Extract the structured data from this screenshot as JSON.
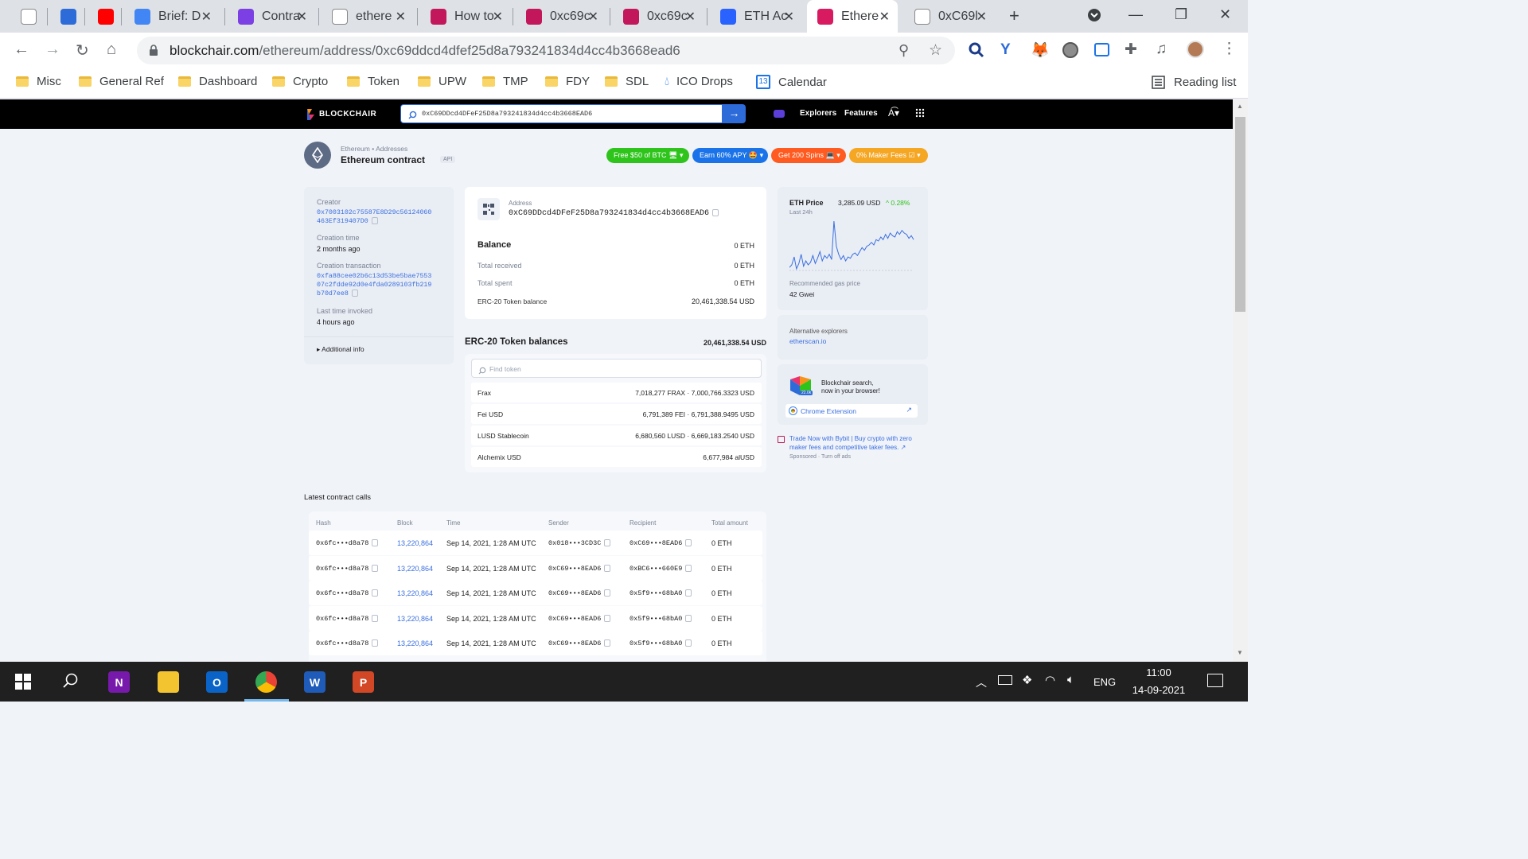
{
  "browser": {
    "tabs": [
      {
        "title": "",
        "icon": "github-icon",
        "color": "#ffffff",
        "fg": "#000000"
      },
      {
        "title": "",
        "icon": "tab-y-icon",
        "color": "#2d6bd9",
        "fg": "#ffffff"
      },
      {
        "title": "",
        "icon": "youtube-icon",
        "color": "#ff0000",
        "fg": "#ffffff"
      },
      {
        "title": "Brief: D",
        "icon": "google-docs-icon",
        "color": "#4285f4",
        "fg": "#ffffff"
      },
      {
        "title": "Contra",
        "icon": "contra-icon",
        "color": "#7b3fe4",
        "fg": "#ffffff"
      },
      {
        "title": "ethere",
        "icon": "google-icon",
        "color": "#ffffff",
        "fg": "#4285f4"
      },
      {
        "title": "How to",
        "icon": "shield-icon",
        "color": "#c2185b",
        "fg": "#ffffff"
      },
      {
        "title": "0xc69c",
        "icon": "shield-icon",
        "color": "#c2185b",
        "fg": "#ffffff"
      },
      {
        "title": "0xc69c",
        "icon": "shield-icon",
        "color": "#c2185b",
        "fg": "#ffffff"
      },
      {
        "title": "ETH Ac",
        "icon": "blue-dots-icon",
        "color": "#2962ff",
        "fg": "#ffffff"
      },
      {
        "title": "Ethere",
        "icon": "blockchair-cube-icon",
        "color": "#d81b60",
        "fg": "#ffffff"
      },
      {
        "title": "0xC69l",
        "icon": "ethereum-icon",
        "color": "#ffffff",
        "fg": "#000000"
      }
    ],
    "url_host": "blockchair.com",
    "url_path": "/ethereum/address/0xc69ddcd4dfef25d8a793241834d4cc4b3668ead6",
    "bookmarks": [
      "Misc",
      "General Ref",
      "Dashboard",
      "Crypto",
      "Token",
      "UPW",
      "TMP",
      "FDY",
      "SDL",
      "ICO Drops",
      "Calendar"
    ],
    "calendar_day": "13",
    "reading_list": "Reading list"
  },
  "site": {
    "logo": "BLOCKCHAIR",
    "search_value": "0xC69DDcd4DFeF25D8a793241834d4cc4b3668EAD6",
    "nav_explorers": "Explorers",
    "nav_features": "Features",
    "breadcrumb_1": "Ethereum",
    "breadcrumb_sep": "•",
    "breadcrumb_2": "Addresses",
    "page_title": "Ethereum contract",
    "api_badge": "API",
    "promos": [
      {
        "label": "Free $50 of BTC 🖥 ▾",
        "color": "#2ec41b"
      },
      {
        "label": "Earn 60% APY 🤩 ▾",
        "color": "#1a73e8"
      },
      {
        "label": "Get 200 Spins 💻 ▾",
        "color": "#ff5a1f"
      },
      {
        "label": "0% Maker Fees ☑ ▾",
        "color": "#f5a623"
      }
    ],
    "info": {
      "creator_label": "Creator",
      "creator_l1": "0x7003102c75587E8D29c56124060",
      "creator_l2": "463Ef319407D0",
      "creation_time_label": "Creation time",
      "creation_time": "2 months ago",
      "creation_tx_label": "Creation transaction",
      "creation_tx_l1": "0xfa88cee02b6c13d53be5bae7553",
      "creation_tx_l2": "07c2fdde92d0e4fda0289103fb219",
      "creation_tx_l3": "b70d7ee8",
      "last_invoked_label": "Last time invoked",
      "last_invoked": "4 hours ago",
      "additional_info": "▸ Additional info"
    },
    "address": {
      "label": "Address",
      "value": "0xC69DDcd4DFeF25D8a793241834d4cc4b3668EAD6",
      "balance_label": "Balance",
      "balance": "0 ETH",
      "received_label": "Total received",
      "received": "0 ETH",
      "spent_label": "Total spent",
      "spent": "0 ETH",
      "erc20_label": "ERC-20 Token balance",
      "erc20": "20,461,338.54 USD"
    },
    "tokens": {
      "title": "ERC-20 Token balances",
      "total": "20,461,338.54 USD",
      "find_placeholder": "Find token",
      "rows": [
        {
          "name": "Frax",
          "value": "7,018,277 FRAX · 7,000,766.3323 USD"
        },
        {
          "name": "Fei USD",
          "value": "6,791,389 FEI · 6,791,388.9495 USD"
        },
        {
          "name": "LUSD Stablecoin",
          "value": "6,680,560 LUSD · 6,669,183.2540 USD"
        },
        {
          "name": "Alchemix USD",
          "value": "6,677,984 alUSD"
        }
      ]
    },
    "eth_price": {
      "label": "ETH Price",
      "price": "3,285.09 USD",
      "change": "^ 0.28%",
      "period": "Last 24h",
      "gas_label": "Recommended gas price",
      "gas": "42 Gwei",
      "series": [
        40,
        44,
        56,
        38,
        46,
        60,
        42,
        50,
        44,
        48,
        58,
        46,
        54,
        64,
        50,
        58,
        54,
        60,
        52,
        110,
        72,
        60,
        52,
        58,
        50,
        56,
        54,
        60,
        62,
        58,
        64,
        70,
        66,
        72,
        74,
        78,
        74,
        82,
        80,
        86,
        82,
        90,
        84,
        92,
        88,
        86,
        94,
        90,
        96,
        92,
        90,
        84,
        88,
        82
      ]
    },
    "alt_explorers": {
      "label": "Alternative explorers",
      "link": "etherscan.io"
    },
    "extension": {
      "line1": "Blockchair search,",
      "line2": "now in your browser!",
      "button": "Chrome Extension",
      "badge": "22.0k"
    },
    "ad": {
      "line1": "Trade Now with Bybit | Buy crypto with zero",
      "line2": "maker fees and competitive taker fees. ↗",
      "sponsored": "Sponsored",
      "sep": "·",
      "turn_off": "Turn off ads"
    },
    "calls": {
      "title": "Latest contract calls",
      "headers": [
        "Hash",
        "Block",
        "Time",
        "Sender",
        "Recipient",
        "Total amount"
      ],
      "rows": [
        {
          "hash": "0x6fc•••d8a78",
          "block": "13,220,864",
          "time": "Sep 14, 2021, 1:28 AM UTC",
          "sender": "0x018•••3CD3C",
          "recipient": "0xC69•••8EAD6",
          "amount": "0 ETH"
        },
        {
          "hash": "0x6fc•••d8a78",
          "block": "13,220,864",
          "time": "Sep 14, 2021, 1:28 AM UTC",
          "sender": "0xC69•••8EAD6",
          "recipient": "0xBC6•••660E9",
          "amount": "0 ETH"
        },
        {
          "hash": "0x6fc•••d8a78",
          "block": "13,220,864",
          "time": "Sep 14, 2021, 1:28 AM UTC",
          "sender": "0xC69•••8EAD6",
          "recipient": "0x5f9•••68bA0",
          "amount": "0 ETH"
        },
        {
          "hash": "0x6fc•••d8a78",
          "block": "13,220,864",
          "time": "Sep 14, 2021, 1:28 AM UTC",
          "sender": "0xC69•••8EAD6",
          "recipient": "0x5f9•••68bA0",
          "amount": "0 ETH"
        },
        {
          "hash": "0x6fc•••d8a78",
          "block": "13,220,864",
          "time": "Sep 14, 2021, 1:28 AM UTC",
          "sender": "0xC69•••8EAD6",
          "recipient": "0x5f9•••68bA0",
          "amount": "0 ETH"
        }
      ]
    }
  },
  "taskbar": {
    "apps": [
      {
        "icon": "onenote-icon",
        "letter": "N",
        "color": "#7719aa"
      },
      {
        "icon": "file-explorer-icon",
        "letter": "",
        "color": "#f4c430"
      },
      {
        "icon": "outlook-icon",
        "letter": "O",
        "color": "#0a64c8"
      },
      {
        "icon": "chrome-icon",
        "letter": "",
        "color": "#ffffff"
      },
      {
        "icon": "word-icon",
        "letter": "W",
        "color": "#1f5bb8"
      },
      {
        "icon": "powerpoint-icon",
        "letter": "P",
        "color": "#d24726"
      }
    ],
    "lang": "ENG",
    "time": "11:00",
    "date": "14-09-2021"
  }
}
